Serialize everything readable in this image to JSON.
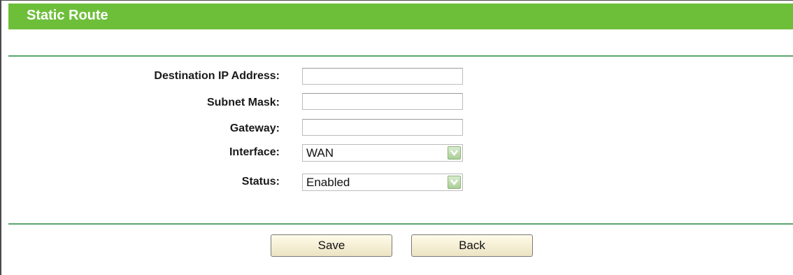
{
  "header": {
    "title": "Static Route"
  },
  "form": {
    "fields": [
      {
        "label": "Destination IP Address:",
        "value": ""
      },
      {
        "label": "Subnet Mask:",
        "value": ""
      },
      {
        "label": "Gateway:",
        "value": ""
      }
    ],
    "interface": {
      "label": "Interface:",
      "selected": "WAN"
    },
    "status": {
      "label": "Status:",
      "selected": "Enabled"
    }
  },
  "buttons": {
    "save_label": "Save",
    "back_label": "Back"
  },
  "colors": {
    "title_bar": "#6dbf3a",
    "divider": "#5aa46f",
    "button_bg": "#f6efd5"
  },
  "icons": {
    "select_arrow": "chevron-down-icon"
  }
}
